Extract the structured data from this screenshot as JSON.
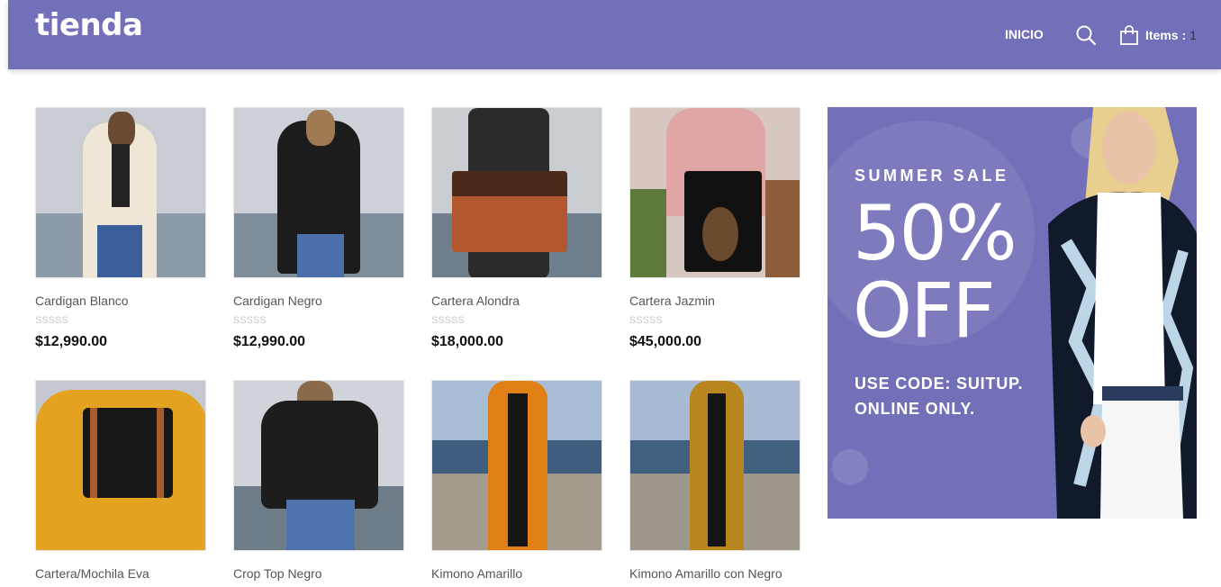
{
  "header": {
    "logo": "tienda",
    "nav_inicio": "INICIO",
    "cart_label": "Items :",
    "cart_count": "1",
    "bg_color": "#7270b8"
  },
  "products": [
    {
      "name": "Cardigan Blanco",
      "rating": "SSSSS",
      "price": "$12,990.00"
    },
    {
      "name": "Cardigan Negro",
      "rating": "SSSSS",
      "price": "$12,990.00"
    },
    {
      "name": "Cartera Alondra",
      "rating": "SSSSS",
      "price": "$18,000.00"
    },
    {
      "name": "Cartera Jazmin",
      "rating": "SSSSS",
      "price": "$45,000.00"
    },
    {
      "name": "Cartera/Mochila Eva"
    },
    {
      "name": "Crop Top Negro"
    },
    {
      "name": "Kimono Amarillo"
    },
    {
      "name": "Kimono Amarillo con Negro"
    }
  ],
  "banner": {
    "line1": "SUMMER SALE",
    "line2": "50%",
    "line3": "OFF",
    "line4": "USE CODE: SUITUP.",
    "line5": "ONLINE ONLY."
  }
}
